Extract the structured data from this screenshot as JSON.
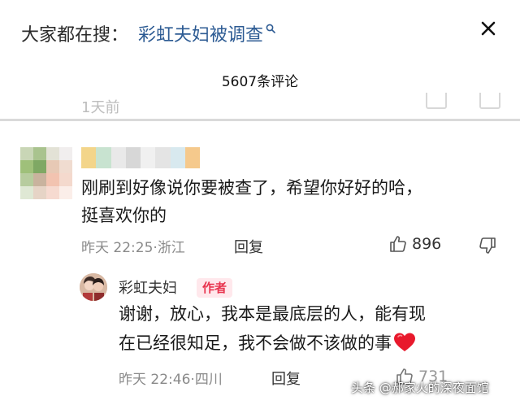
{
  "header": {
    "search_prefix": "大家都在搜：",
    "search_term": "彩虹夫妇被调查",
    "close_icon": "close-icon",
    "comment_count": "5607条评论"
  },
  "previous_comment": {
    "time_partial": "1天前"
  },
  "comment": {
    "text_line1": "刚刷到好像说你要被查了，希望你好好的哈，",
    "text_line2": "挺喜欢你的",
    "date": "昨天",
    "time": "22:25",
    "sep": "·",
    "location": "浙江",
    "reply_label": "回复",
    "likes": "896"
  },
  "reply": {
    "username": "彩虹夫妇",
    "badge": "作者",
    "text_line1": "谢谢，放心，我本是最底层的人，能有现",
    "text_line2": "在已经很知足，我不会做不该做的事",
    "date": "昨天",
    "time": "22:46",
    "sep": "·",
    "location": "四川",
    "reply_label": "回复",
    "likes": "731"
  },
  "watermark": "头条 @郝家火的深夜面馆",
  "colors": {
    "link_blue": "#2d5b93",
    "badge_red": "#e8344e",
    "badge_bg": "#ffe8ec",
    "heart_red": "#e8192c",
    "meta_gray": "#8a8a8a"
  }
}
